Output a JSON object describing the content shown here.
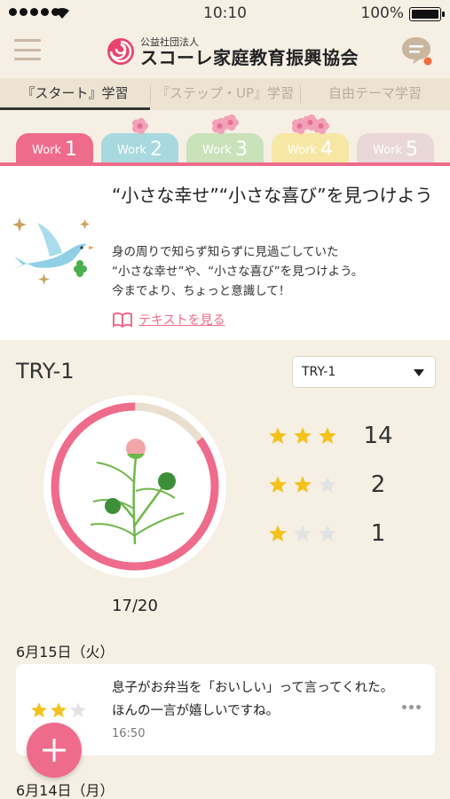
{
  "status_bar": {
    "time": "10:10",
    "battery": "100%",
    "signal_dots": 5
  },
  "header": {
    "org_sub": "公益社団法人",
    "org_name": "スコーレ家庭教育振興協会",
    "menu_icon": "hamburger-icon",
    "chat_icon": "chat-bubble-icon",
    "notification_dot_color": "#f26b3a"
  },
  "mode_tabs": [
    {
      "label": "『スタート』学習",
      "active": true
    },
    {
      "label": "『ステップ・UP』学習",
      "active": false
    },
    {
      "label": "自由テーマ学習",
      "active": false
    }
  ],
  "work_tabs": [
    {
      "label": "Work",
      "num": "1",
      "color": "#ef6b8c",
      "flowers": 0
    },
    {
      "label": "Work",
      "num": "2",
      "color": "#a7d9de",
      "flowers": 1
    },
    {
      "label": "Work",
      "num": "3",
      "color": "#c9e2ba",
      "flowers": 2
    },
    {
      "label": "Work",
      "num": "4",
      "color": "#f6e7a5",
      "flowers": 3
    },
    {
      "label": "Work",
      "num": "5",
      "color": "#ead8d8",
      "flowers": 0
    }
  ],
  "card": {
    "title": "“小さな幸せ”“小さな喜び”を見つけよう",
    "desc": [
      "身の周りで知らず知らずに見過ごしていた",
      "“小さな幸せ”や、“小さな喜び”を見つけよう。",
      "今までより、ちょっと意識して！"
    ],
    "text_link": "テキストを見る",
    "text_link_icon": "book-icon"
  },
  "try": {
    "title": "TRY-1",
    "select_value": "TRY-1",
    "progress_label": "17/20",
    "progress_fraction": 0.85
  },
  "ratings": [
    {
      "stars": 3,
      "count": "14"
    },
    {
      "stars": 2,
      "count": "2"
    },
    {
      "stars": 1,
      "count": "1"
    }
  ],
  "entries": {
    "date1": "6月15日（火）",
    "entry": {
      "stars": 2,
      "text": "息子がお弁当を「おいしい」って言ってくれた。ほんの一言が嬉しいですね。",
      "time": "16:50"
    },
    "date2": "6月14日（月）"
  },
  "colors": {
    "accent": "#ef6b8c",
    "star_on": "#f3c21b",
    "star_off": "#e3e3e3",
    "background": "#f5efe4"
  }
}
